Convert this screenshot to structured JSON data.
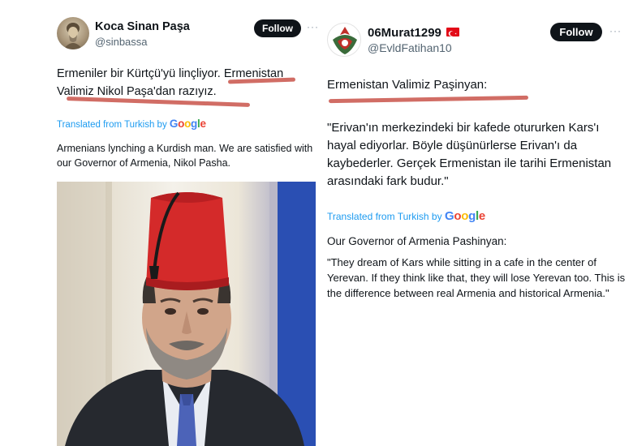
{
  "left_tweet": {
    "author_name": "Koca Sinan Paşa",
    "handle": "@sinbassa",
    "follow_label": "Follow",
    "more_label": "···",
    "text": "Ermeniler bir Kürtçü'yü linçliyor. Ermenistan Valimiz Nikol Paşa'dan razıyız.",
    "translated_label": "Translated from Turkish by",
    "google_label": "Google",
    "translation": "Armenians lynching a Kurdish man. We are satisfied with our Governor of Armenia, Nikol Pasha."
  },
  "right_tweet": {
    "author_name": "06Murat1299",
    "handle": "@EvldFatihan10",
    "follow_label": "Follow",
    "more_label": "···",
    "heading": "Ermenistan Valimiz Paşinyan:",
    "text": "\"Erivan'ın merkezindeki bir kafede otururken Kars'ı hayal ediyorlar. Böyle düşünürlerse Erivan'ı da kaybederler. Gerçek Ermenistan ile tarihi Ermenistan arasındaki fark budur.\"",
    "translated_label": "Translated from Turkish by",
    "google_label": "Google",
    "translation_heading": "Our Governor of Armenia Pashinyan:",
    "translation": "\"They dream of Kars while sitting in a cafe in the center of Yerevan. If they think like that, they will lose Yerevan too. This is the difference between real Armenia and historical Armenia.\""
  },
  "colors": {
    "follow_bg": "#0f1419",
    "link_blue": "#1d9bf0",
    "underline_red": "#c9544a",
    "fez_red": "#d42a2a"
  }
}
